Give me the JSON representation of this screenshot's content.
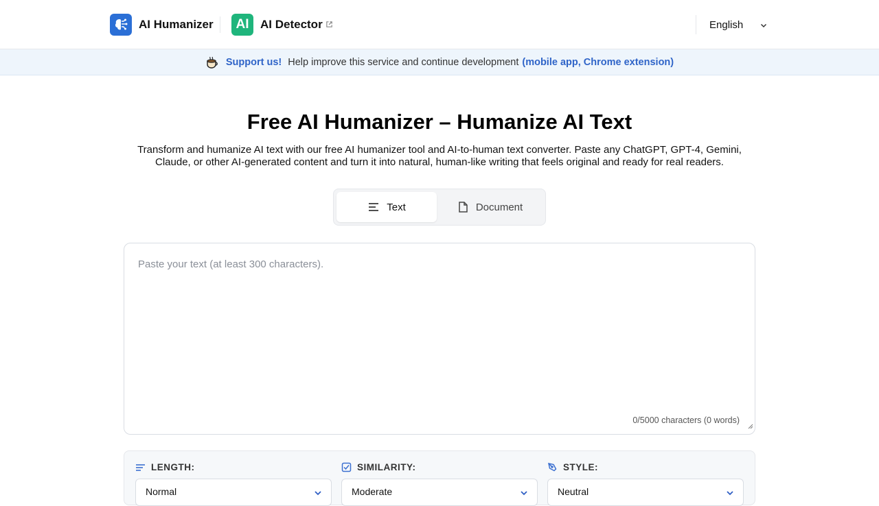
{
  "header": {
    "humanizer_label": "AI Humanizer",
    "detector_logo": "AI",
    "detector_label": "AI Detector",
    "language": "English",
    "icons": {
      "humanizer_logo": "brain-circuit-icon",
      "external": "external-link-icon",
      "language_chevron": "chevron-down-icon"
    }
  },
  "banner": {
    "support_label": "Support us!",
    "message": "Help improve this service and continue development",
    "links_label": "(mobile app, Chrome extension)",
    "icon": "coffee-cup-icon"
  },
  "hero": {
    "title": "Free AI Humanizer – Humanize AI Text",
    "subtitle": "Transform and humanize AI text with our free AI humanizer tool and AI-to-human text converter. Paste any ChatGPT, GPT-4, Gemini, Claude, or other AI-generated content and turn it into natural, human-like writing that feels original and ready for real readers."
  },
  "tabs": [
    {
      "label": "Text",
      "active": true,
      "icon": "text-lines-icon"
    },
    {
      "label": "Document",
      "active": false,
      "icon": "document-icon"
    }
  ],
  "editor": {
    "placeholder": "Paste your text (at least 300 characters).",
    "value": "",
    "counter": "0/5000 characters (0 words)"
  },
  "options": {
    "length": {
      "label": "LENGTH:",
      "value": "Normal",
      "icon": "lines-icon"
    },
    "similarity": {
      "label": "SIMILARITY:",
      "value": "Moderate",
      "icon": "checkbox-icon"
    },
    "style": {
      "label": "STYLE:",
      "value": "Neutral",
      "icon": "pen-tool-icon"
    }
  },
  "colors": {
    "accent_blue": "#2f64c8",
    "humanizer_logo": "#2b6fd6",
    "detector_logo": "#1fb57c",
    "banner_bg": "#eef5fc"
  }
}
